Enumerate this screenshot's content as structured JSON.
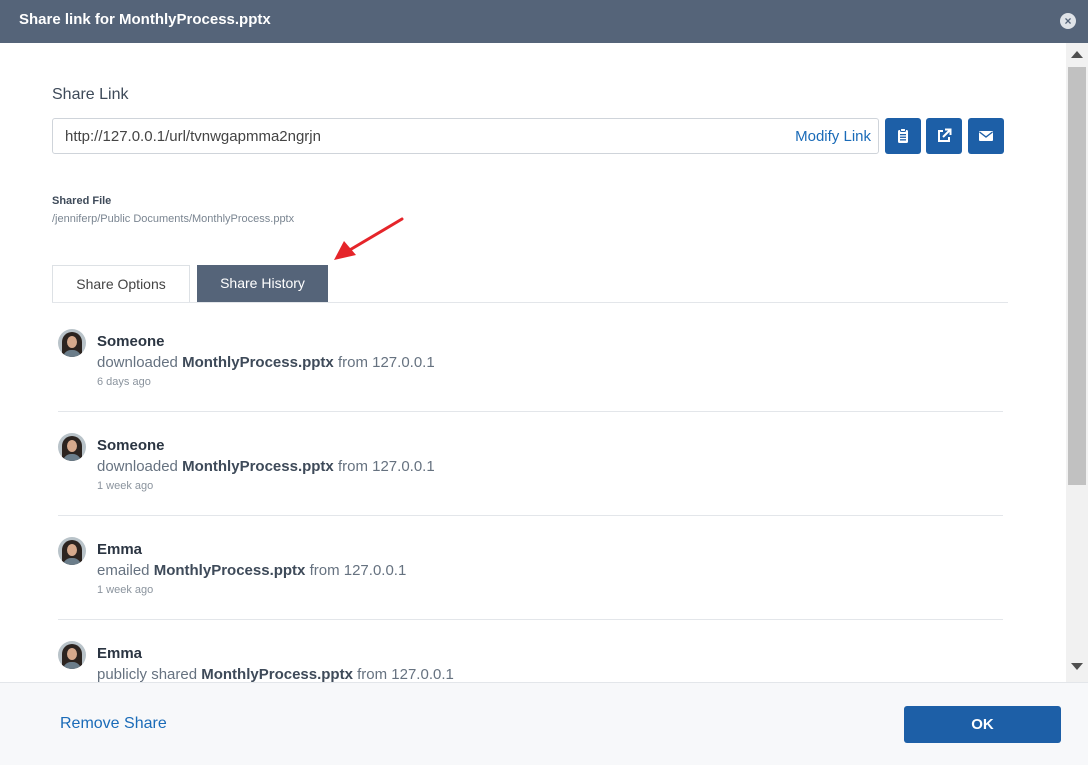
{
  "dialog": {
    "title": "Share link for MonthlyProcess.pptx",
    "close_icon": "close-icon"
  },
  "share_link": {
    "label": "Share Link",
    "url": "http://127.0.0.1/url/tvnwgapmma2ngrjn",
    "modify_label": "Modify Link",
    "buttons": [
      "copy-clipboard-icon",
      "open-external-icon",
      "email-icon"
    ]
  },
  "shared_file": {
    "label": "Shared File",
    "path": "/jenniferp/Public Documents/MonthlyProcess.pptx"
  },
  "tabs": [
    {
      "label": "Share Options",
      "active": false
    },
    {
      "label": "Share History",
      "active": true
    }
  ],
  "history": [
    {
      "name": "Someone",
      "verb": "downloaded",
      "file": "MonthlyProcess.pptx",
      "source": "from 127.0.0.1",
      "time": "6 days ago"
    },
    {
      "name": "Someone",
      "verb": "downloaded",
      "file": "MonthlyProcess.pptx",
      "source": "from 127.0.0.1",
      "time": "1 week ago"
    },
    {
      "name": "Emma",
      "verb": "emailed",
      "file": "MonthlyProcess.pptx",
      "source": "from 127.0.0.1",
      "time": "1 week ago"
    },
    {
      "name": "Emma",
      "verb": "publicly shared",
      "file": "MonthlyProcess.pptx",
      "source": "from 127.0.0.1",
      "time": ""
    }
  ],
  "footer": {
    "remove_label": "Remove Share",
    "ok_label": "OK"
  },
  "colors": {
    "titlebar": "#556479",
    "primary": "#1d5fa7",
    "link": "#1a6bb8",
    "arrow": "#e5252a"
  }
}
